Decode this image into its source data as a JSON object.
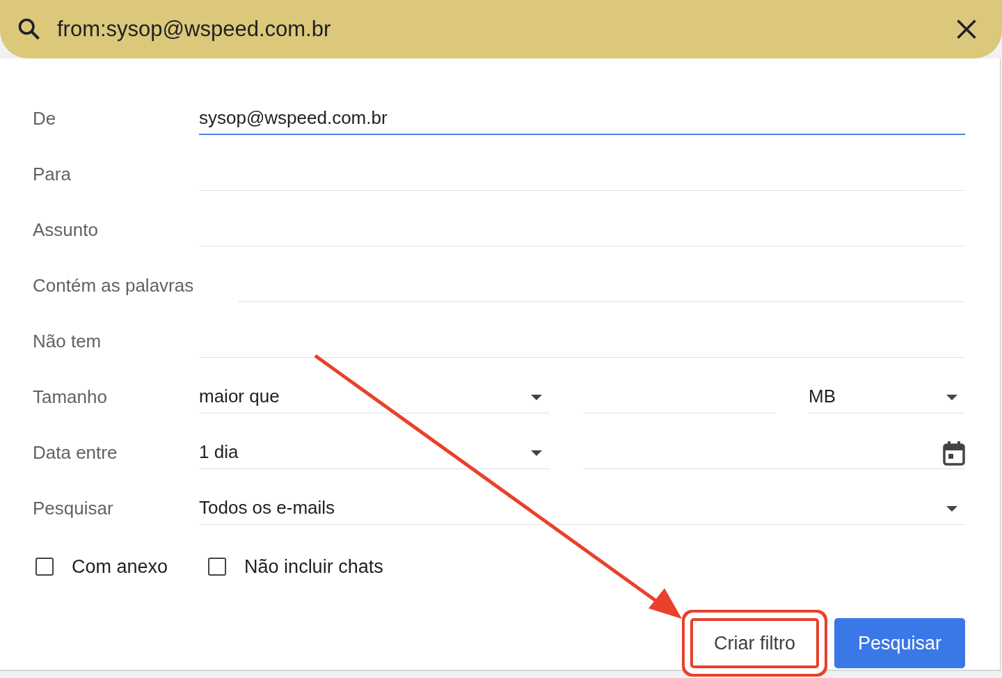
{
  "search_bar": {
    "query": "from:sysop@wspeed.com.br"
  },
  "rows": [
    {
      "kind": "text",
      "label": "De",
      "value": "sysop@wspeed.com.br",
      "focused": true
    },
    {
      "kind": "text",
      "label": "Para",
      "focused": false
    },
    {
      "kind": "text",
      "label": "Assunto",
      "focused": false
    },
    {
      "kind": "text",
      "label": "Contém as palavras",
      "focused": false
    },
    {
      "kind": "text",
      "label": "Não tem",
      "focused": false
    },
    {
      "kind": "size",
      "label": "Tamanho",
      "operator": "maior que",
      "unit": "MB"
    },
    {
      "kind": "date",
      "label": "Data entre",
      "range": "1 dia"
    },
    {
      "kind": "select",
      "label": "Pesquisar",
      "value": "Todos os e-mails"
    }
  ],
  "checkboxes": [
    {
      "label": "Com anexo",
      "checked": false
    },
    {
      "label": "Não incluir chats",
      "checked": false
    }
  ],
  "buttons": [
    {
      "kind": "secondary",
      "label": "Criar filtro",
      "highlighted": true
    },
    {
      "kind": "primary",
      "label": "Pesquisar",
      "highlighted": false
    }
  ]
}
